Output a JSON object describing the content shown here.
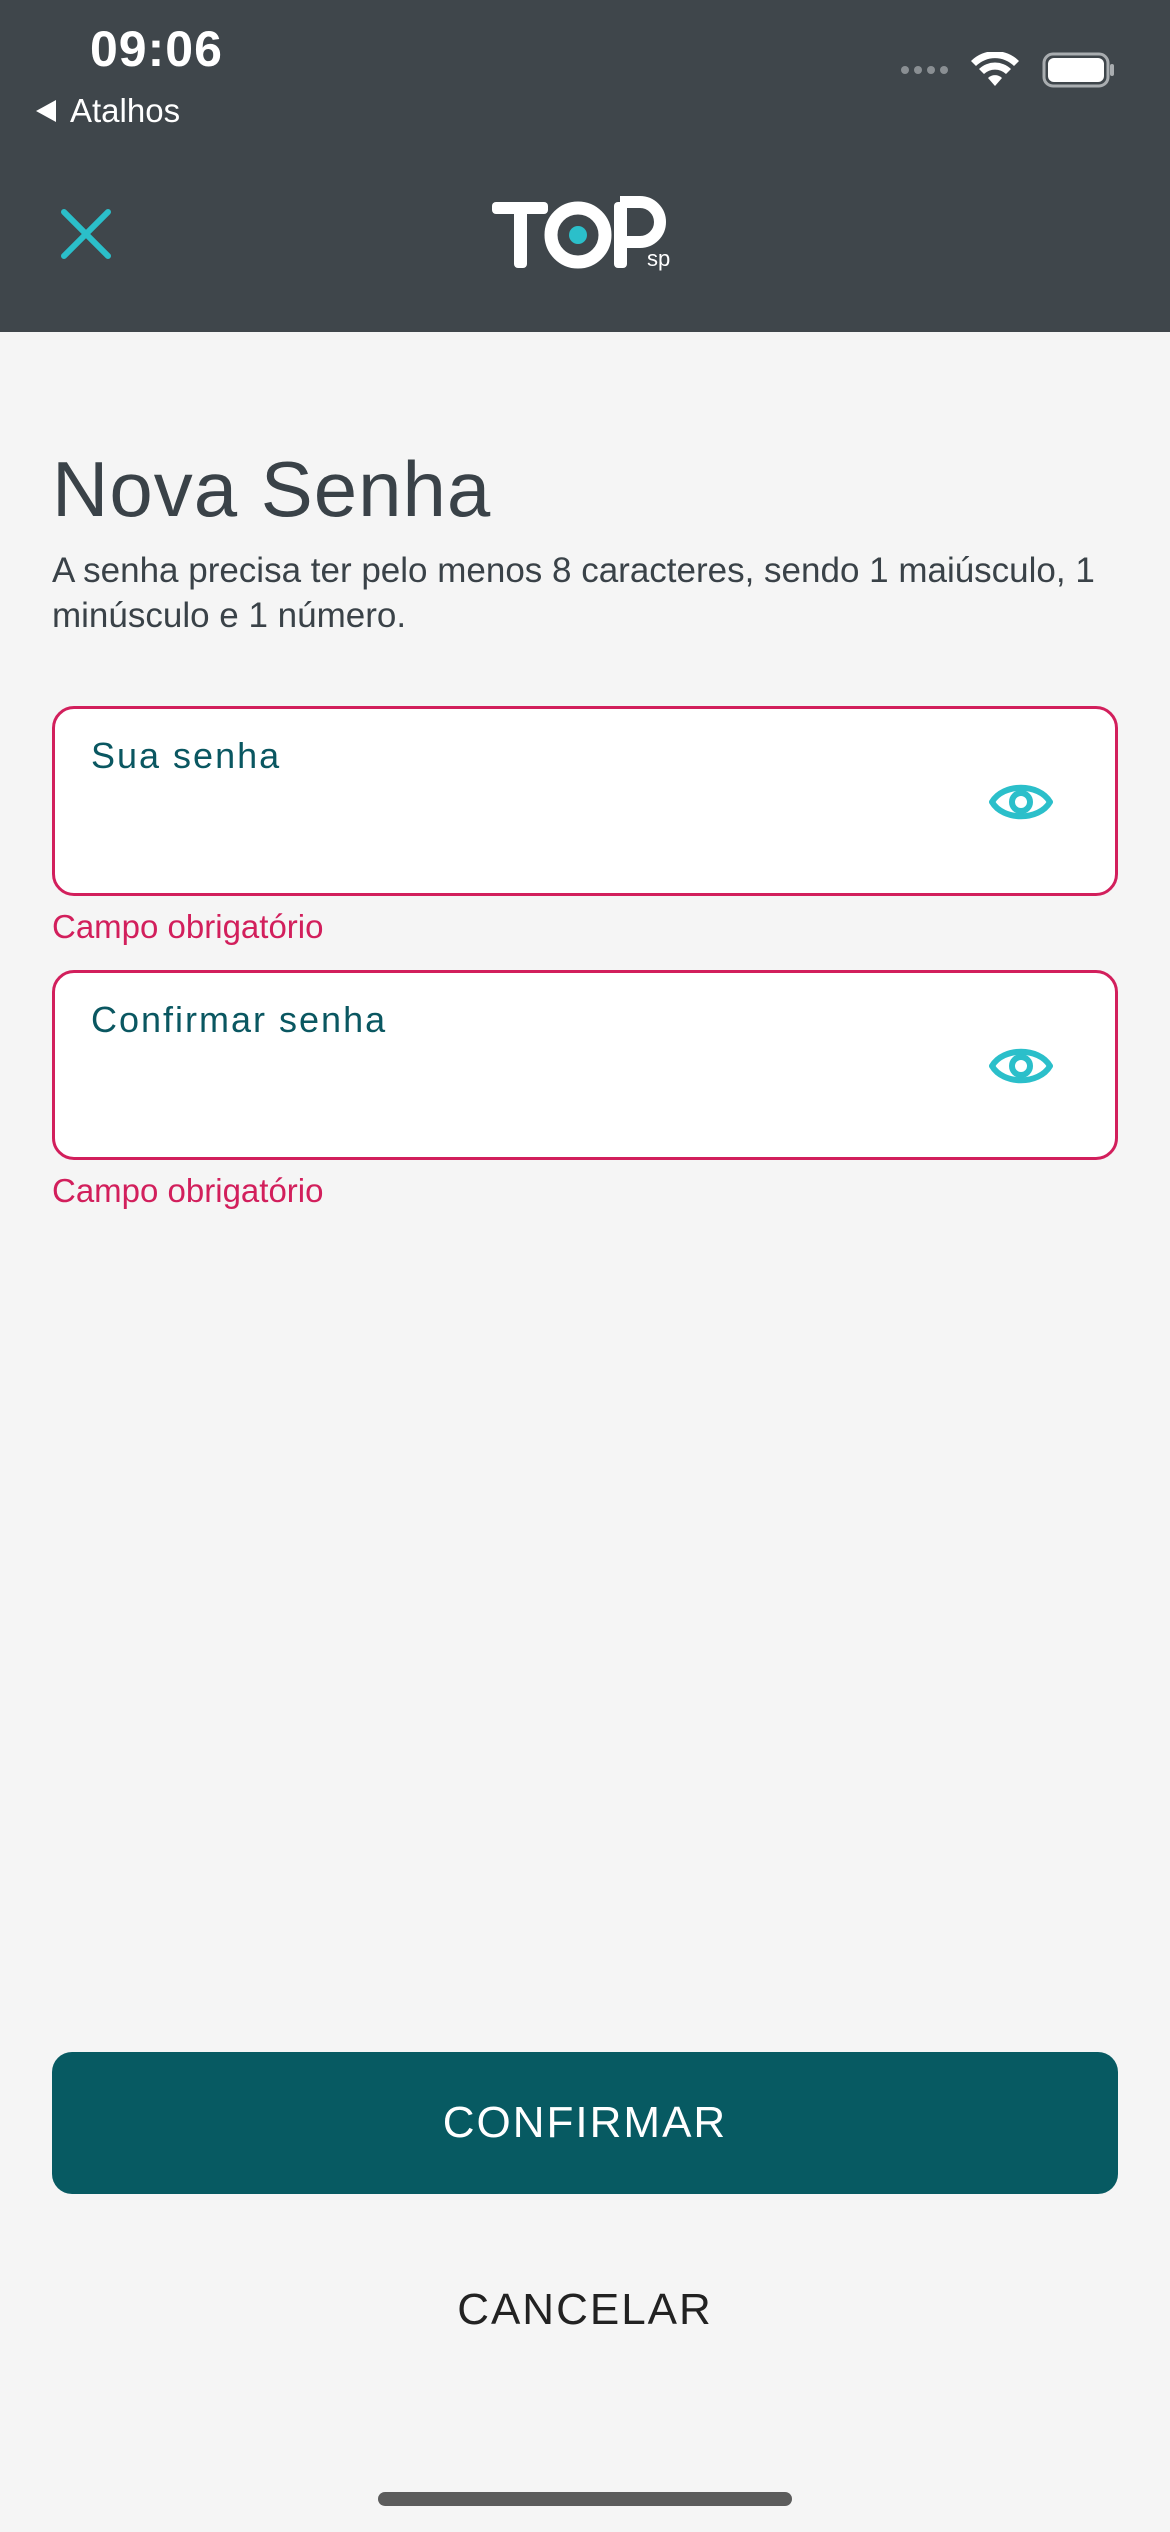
{
  "status_bar": {
    "time": "09:06",
    "back_label": "Atalhos"
  },
  "header": {
    "logo_text": "TOP",
    "logo_suffix": "sp",
    "close_icon": "close-icon",
    "accent_color": "#2bbfca"
  },
  "page": {
    "title": "Nova Senha",
    "subtitle": "A senha precisa ter pelo menos 8 caracteres, sendo 1 maiúsculo, 1 minúsculo e 1 número."
  },
  "fields": [
    {
      "label": "Sua senha",
      "value": "",
      "error": "Campo obrigatório",
      "icon": "eye-icon"
    },
    {
      "label": "Confirmar senha",
      "value": "",
      "error": "Campo obrigatório",
      "icon": "eye-icon"
    }
  ],
  "actions": {
    "confirm_label": "CONFIRMAR",
    "cancel_label": "CANCELAR"
  },
  "colors": {
    "header_bg": "#3f464b",
    "primary": "#075a62",
    "error": "#d21f5c",
    "accent": "#2bbfca"
  }
}
